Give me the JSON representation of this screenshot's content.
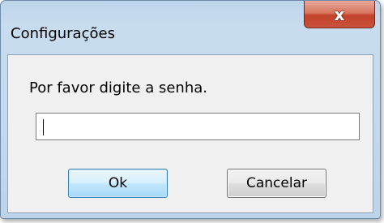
{
  "window": {
    "title": "Configurações",
    "close_glyph": "x"
  },
  "dialog": {
    "prompt": "Por favor digite a senha.",
    "password_value": "",
    "ok_label": "Ok",
    "cancel_label": "Cancelar"
  },
  "colors": {
    "titlebar": "#c8dcef",
    "close_button": "#c4412a",
    "client_background": "#f0f0f0",
    "default_button_border": "#3c7fb1"
  },
  "icons": {
    "close": "close-icon"
  }
}
